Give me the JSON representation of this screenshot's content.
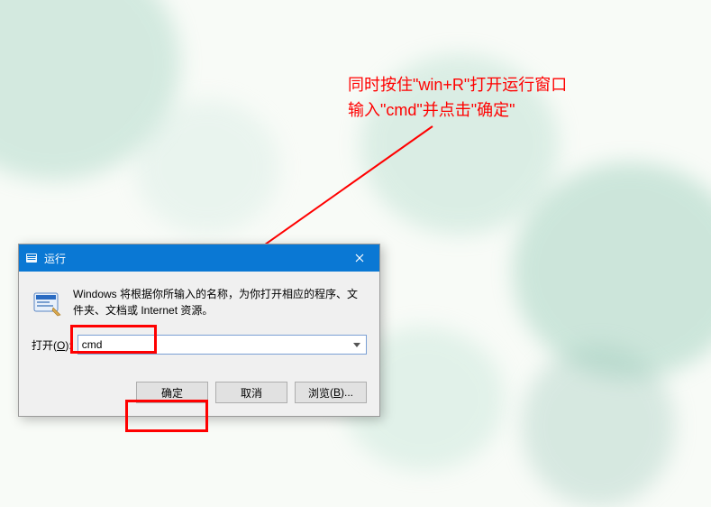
{
  "annotation": {
    "line1": "同时按住\"win+R\"打开运行窗口",
    "line2": "输入\"cmd\"并点击\"确定\""
  },
  "dialog": {
    "title": "运行",
    "description": "Windows 将根据你所输入的名称，为你打开相应的程序、文件夹、文档或 Internet 资源。",
    "open_label_text": "打开",
    "open_accel": "O",
    "input_value": "cmd",
    "ok_label": "确定",
    "cancel_label": "取消",
    "browse_label": "浏览",
    "browse_accel": "B"
  },
  "colors": {
    "annotation_red": "#ff0000",
    "titlebar_blue": "#0a78d4"
  }
}
